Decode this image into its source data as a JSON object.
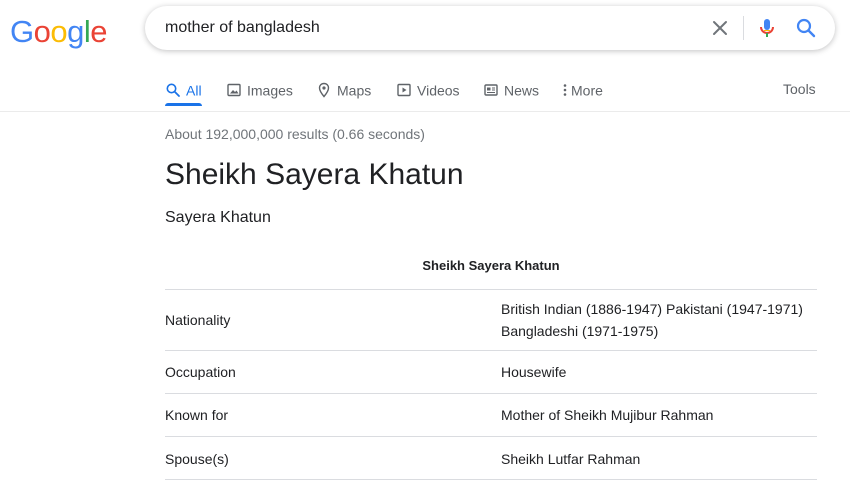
{
  "logo": {
    "letters": [
      "G",
      "o",
      "o",
      "g",
      "l",
      "e"
    ],
    "colors": [
      "#4285F4",
      "#EA4335",
      "#FBBC05",
      "#4285F4",
      "#34A853",
      "#EA4335"
    ]
  },
  "search": {
    "query": "mother of bangladesh"
  },
  "tabs": [
    {
      "label": "All",
      "icon": "search-icon",
      "active": true
    },
    {
      "label": "Images",
      "icon": "image-icon"
    },
    {
      "label": "Maps",
      "icon": "map-pin-icon"
    },
    {
      "label": "Videos",
      "icon": "video-icon"
    },
    {
      "label": "News",
      "icon": "news-icon"
    },
    {
      "label": "More",
      "icon": "more-vert-icon"
    }
  ],
  "tools_label": "Tools",
  "result_stats": "About 192,000,000 results (0.66 seconds)",
  "knowledge_panel": {
    "title": "Sheikh Sayera Khatun",
    "subtitle": "Sayera Khatun",
    "table_caption": "Sheikh Sayera Khatun",
    "rows": [
      {
        "key": "Nationality",
        "value_lines": [
          "British Indian (1886-1947) Pakistani (1947-1971)",
          "Bangladeshi (1971-1975)"
        ]
      },
      {
        "key": "Occupation",
        "value_lines": [
          "Housewife"
        ]
      },
      {
        "key": "Known for",
        "value_lines": [
          "Mother of Sheikh Mujibur Rahman"
        ]
      },
      {
        "key": "Spouse(s)",
        "value_lines": [
          "Sheikh Lutfar Rahman"
        ]
      }
    ]
  },
  "colors": {
    "accent": "#1a73e8",
    "muted": "#5f6368",
    "text": "#202124"
  }
}
